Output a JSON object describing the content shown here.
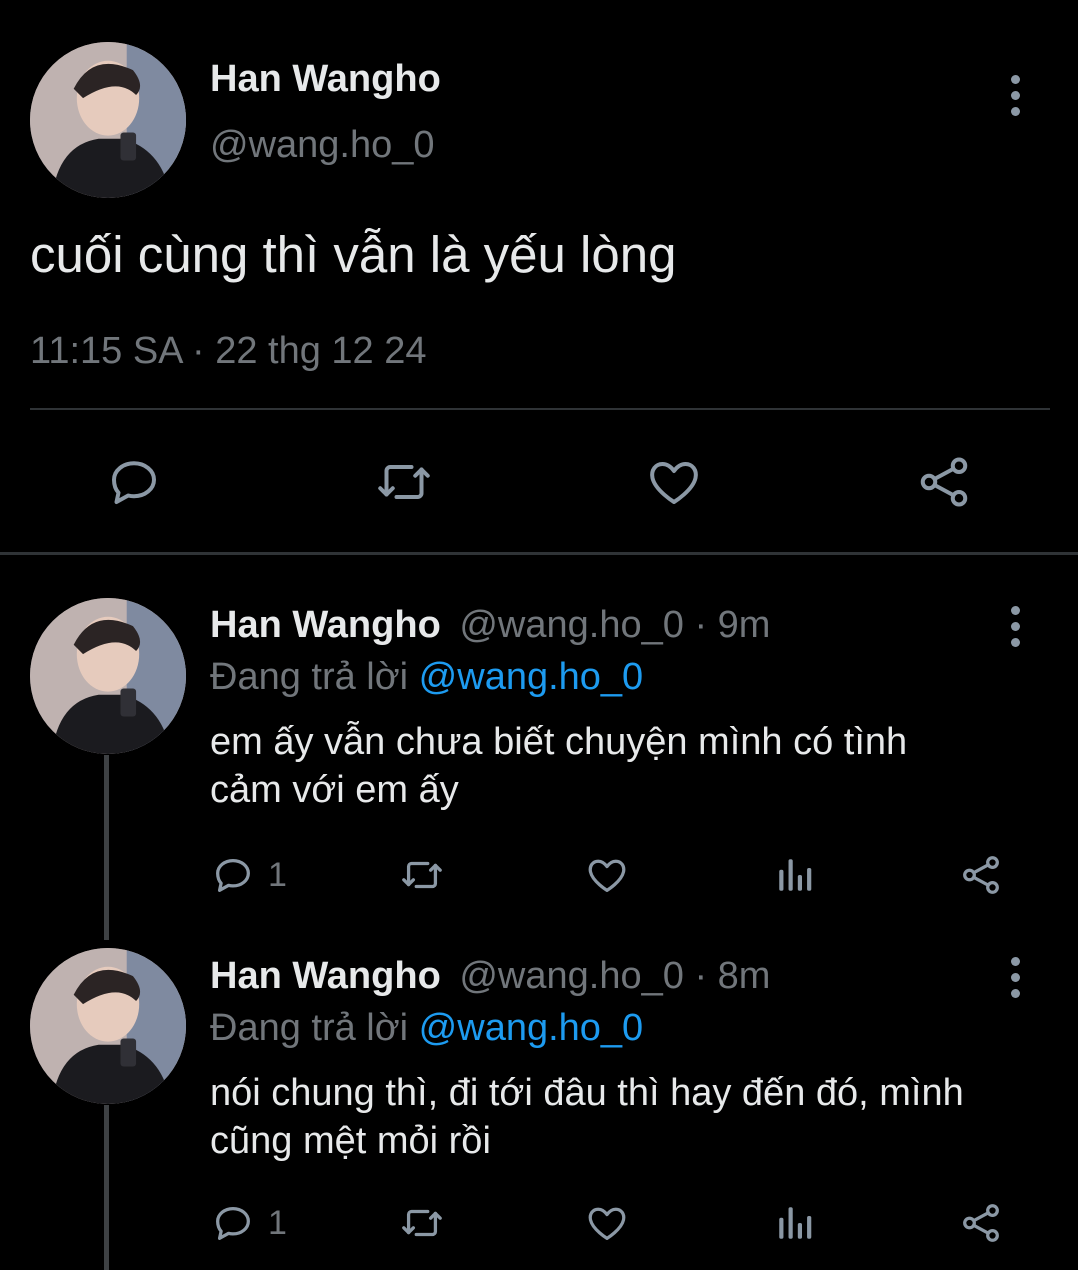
{
  "main_tweet": {
    "author_name": "Han Wangho",
    "author_handle": "@wang.ho_0",
    "text": "cuối cùng thì vẫn là yếu lòng",
    "timestamp": "11:15 SA · 22 thg 12 24"
  },
  "replies": [
    {
      "author_name": "Han Wangho",
      "author_handle": "@wang.ho_0",
      "time": "· 9m",
      "replying_label": "Đang trả lời",
      "replying_to": "@wang.ho_0",
      "text_line1": "em ấy vẫn chưa biết chuyện mình có tình",
      "text_line2": "cảm với em ấy",
      "reply_count": "1"
    },
    {
      "author_name": "Han Wangho",
      "author_handle": "@wang.ho_0",
      "time": "· 8m",
      "replying_label": "Đang trả lời",
      "replying_to": "@wang.ho_0",
      "text_line1": "nói chung thì, đi tới đâu thì hay đến đó, mình",
      "text_line2": "cũng mệt mỏi rồi",
      "reply_count": "1"
    }
  ],
  "colors": {
    "background": "#000000",
    "text": "#e7e9ea",
    "muted": "#71767b",
    "link": "#1d9bf0",
    "divider": "#2f3336"
  }
}
